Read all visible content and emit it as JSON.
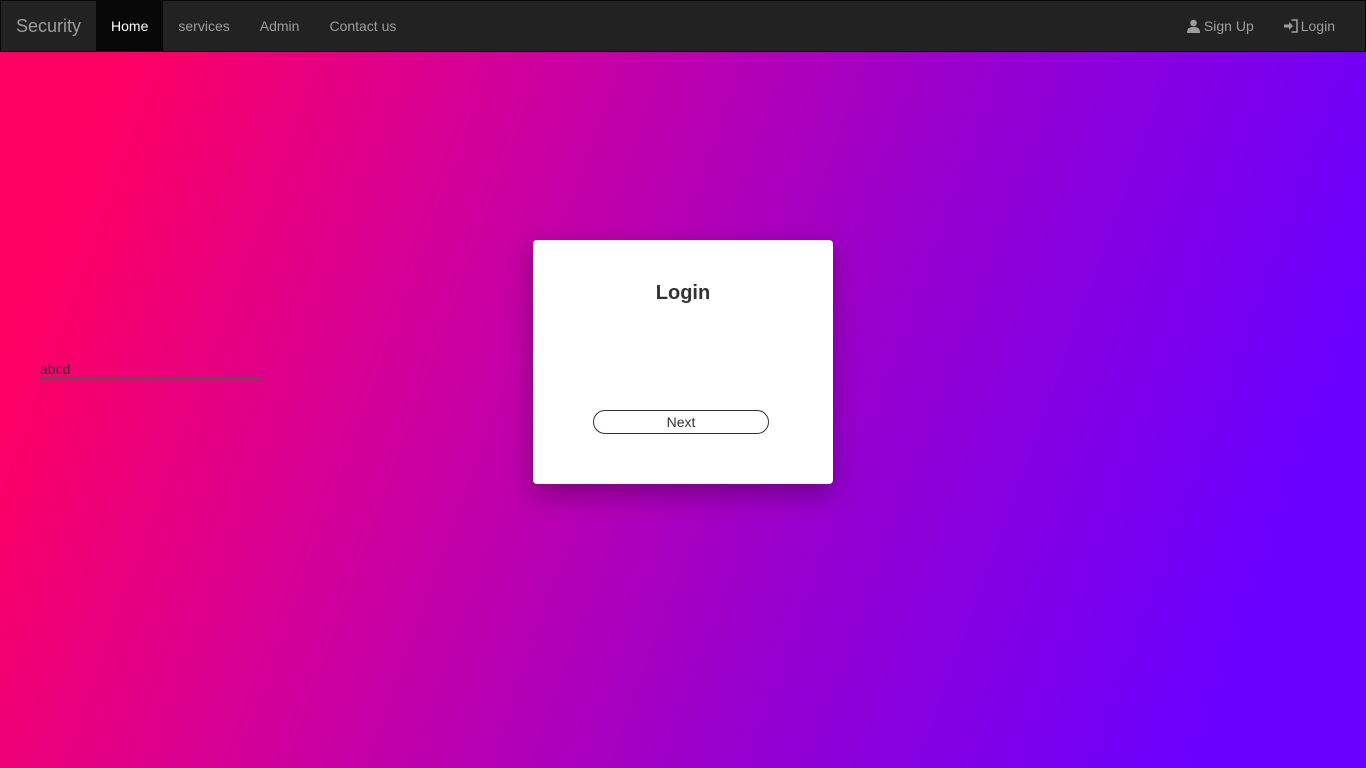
{
  "navbar": {
    "brand": "Security",
    "items": [
      {
        "label": "Home",
        "active": true
      },
      {
        "label": "services"
      },
      {
        "label": "Admin"
      },
      {
        "label": "Contact us"
      }
    ],
    "right_items": [
      {
        "label": "Sign Up",
        "icon": "user-icon"
      },
      {
        "label": "Login",
        "icon": "log-in-icon"
      }
    ]
  },
  "login_card": {
    "title": "Login",
    "username_value": "abcd",
    "next_label": "Next"
  },
  "colors": {
    "navbar_bg": "#222222",
    "navbar_active_bg": "#080808",
    "navbar_text": "#9d9d9d",
    "gradient_start": "#ff0062",
    "gradient_end": "#6a00ff"
  }
}
